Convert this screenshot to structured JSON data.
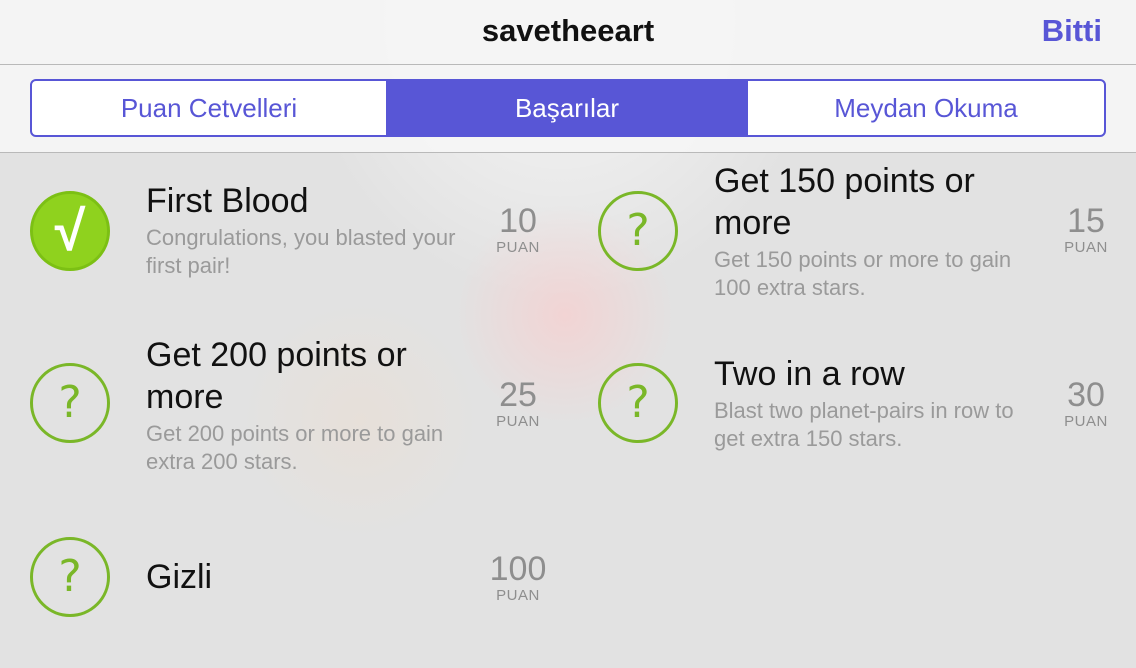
{
  "nav": {
    "title": "savetheeart",
    "done_label": "Bitti"
  },
  "segments": [
    {
      "label": "Puan Cetvelleri",
      "selected": false
    },
    {
      "label": "Başarılar",
      "selected": true
    },
    {
      "label": "Meydan Okuma",
      "selected": false
    }
  ],
  "colors": {
    "accent": "#5856d6",
    "achievement_green": "#8fd21e",
    "locked_ring": "#7ab728"
  },
  "achievements": [
    {
      "title": "First Blood",
      "description": "Congrulations, you blasted your first pair!",
      "points": "10",
      "unit": "PUAN",
      "icon": "check-icon",
      "unlocked": true
    },
    {
      "title": "Get 150 points or more",
      "description": "Get 150 points or more to gain 100 extra stars.",
      "points": "15",
      "unit": "PUAN",
      "icon": "question-icon",
      "unlocked": false
    },
    {
      "title": "Get 200 points or more",
      "description": "Get 200 points or more to gain extra 200 stars.",
      "points": "25",
      "unit": "PUAN",
      "icon": "question-icon",
      "unlocked": false
    },
    {
      "title": "Two in a row",
      "description": "Blast two planet-pairs in row to get extra 150 stars.",
      "points": "30",
      "unit": "PUAN",
      "icon": "question-icon",
      "unlocked": false
    },
    {
      "title": "Gizli",
      "description": "",
      "points": "100",
      "unit": "PUAN",
      "icon": "question-icon",
      "unlocked": false
    }
  ]
}
